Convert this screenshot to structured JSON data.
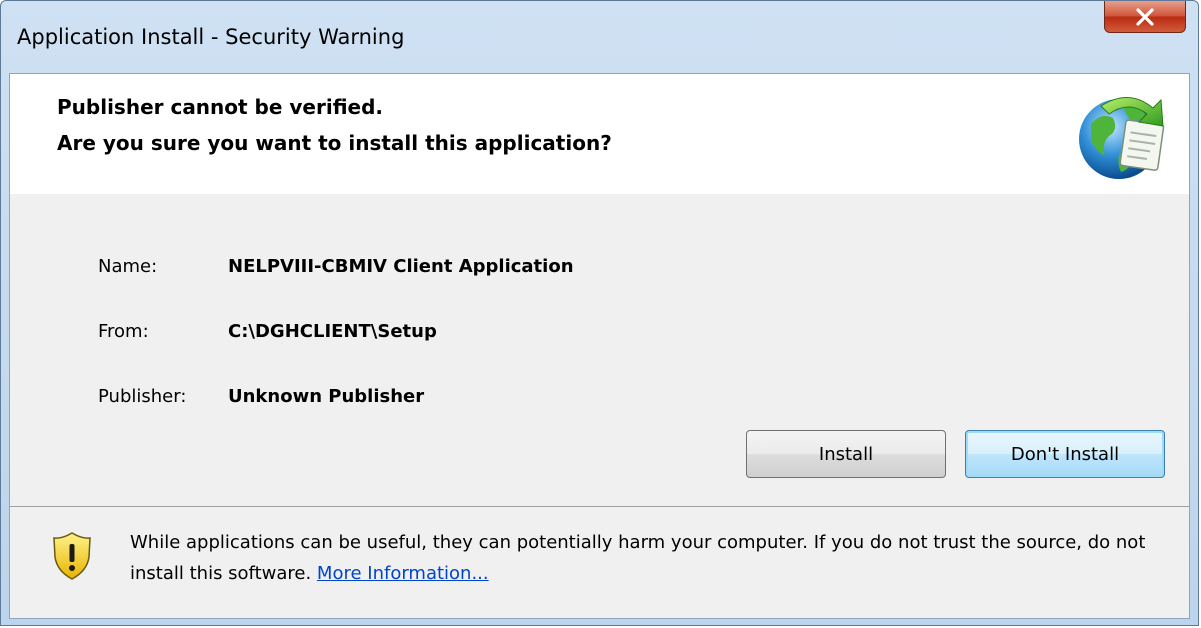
{
  "window": {
    "title": "Application Install - Security Warning"
  },
  "header": {
    "line1": "Publisher cannot be verified.",
    "line2": "Are you sure you want to install this application?",
    "icon": "globe-install-icon"
  },
  "details": {
    "name_label": "Name:",
    "name_value": "NELPVIII-CBMIV Client Application",
    "from_label": "From:",
    "from_value": "C:\\DGHCLIENT\\Setup",
    "publisher_label": "Publisher:",
    "publisher_value": "Unknown Publisher"
  },
  "buttons": {
    "install": "Install",
    "dont_install": "Don't Install"
  },
  "footer": {
    "warning_text": "While applications can be useful, they can potentially harm your computer. If you do not trust the source, do not install this software.",
    "link_text": "More Information...",
    "icon": "warning-shield-icon"
  },
  "colors": {
    "link": "#0044cc",
    "close_button": "#c8452c",
    "title_bar": "#c6dbf0"
  }
}
